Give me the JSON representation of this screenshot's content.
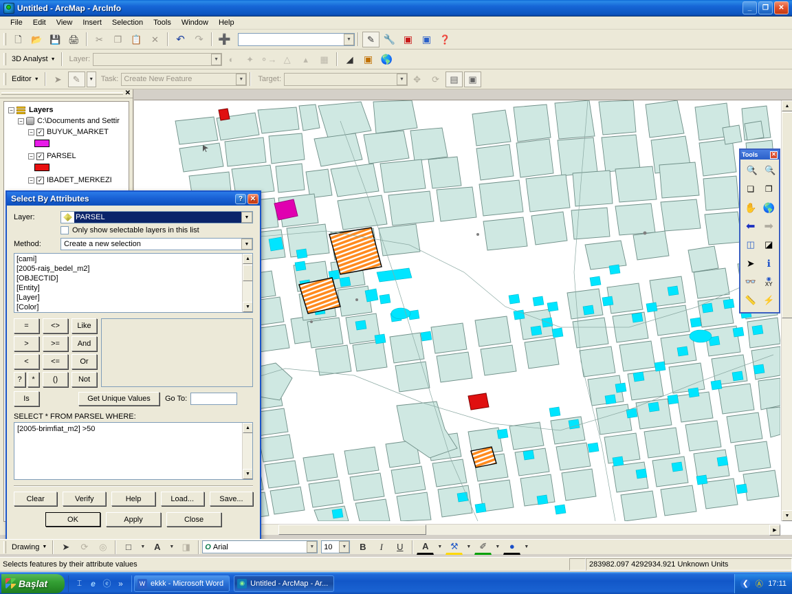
{
  "window": {
    "title": "Untitled - ArcMap - ArcInfo",
    "minimize": "_",
    "maximize": "❐",
    "close": "✕"
  },
  "menubar": {
    "items": [
      "File",
      "Edit",
      "View",
      "Insert",
      "Selection",
      "Tools",
      "Window",
      "Help"
    ]
  },
  "toolbars": {
    "standard": {
      "buttons": [
        {
          "name": "new-document-icon",
          "glyph": "🗋"
        },
        {
          "name": "open-document-icon",
          "glyph": "📂"
        },
        {
          "name": "save-icon",
          "glyph": "💾"
        },
        {
          "name": "print-icon",
          "glyph": "🖨"
        },
        {
          "name": "cut-icon",
          "glyph": "✂"
        },
        {
          "name": "copy-icon",
          "glyph": "❐"
        },
        {
          "name": "paste-icon",
          "glyph": "📋"
        },
        {
          "name": "delete-icon",
          "glyph": "✕"
        },
        {
          "name": "undo-icon",
          "glyph": "↶"
        },
        {
          "name": "redo-icon",
          "glyph": "↷"
        },
        {
          "name": "add-data-icon",
          "glyph": "➕"
        }
      ],
      "scale_value": "",
      "editor_toolbar_icon": "✎",
      "right_buttons": [
        {
          "name": "arctoolbox-icon",
          "glyph": "🔧"
        },
        {
          "name": "command-line-icon",
          "glyph": "▣"
        },
        {
          "name": "show-help-icon",
          "glyph": "❓"
        }
      ]
    },
    "analyst3d": {
      "menu_label": "3D Analyst",
      "layer_label": "Layer:",
      "layer_value": ""
    },
    "editor": {
      "menu_label": "Editor",
      "task_label": "Task:",
      "task_value": "Create New Feature",
      "target_label": "Target:",
      "target_value": ""
    },
    "drawing": {
      "menu_label": "Drawing",
      "font_name": "Arial",
      "font_size": "10",
      "bold": "B",
      "italic": "I",
      "underline": "U",
      "font_color": "A",
      "fill_color": "⚒",
      "line_color": "✐",
      "marker_color": "●"
    }
  },
  "toc": {
    "close_label": "✕",
    "nodes": [
      {
        "label": "Layers",
        "kind": "root"
      },
      {
        "label": "C:\\Documents and Settir",
        "kind": "datasource"
      },
      {
        "label": "BUYUK_MARKET",
        "kind": "layer",
        "checked": true,
        "swatch": "#e81ce8"
      },
      {
        "label": "PARSEL",
        "kind": "layer",
        "checked": true,
        "swatch": "#e81010"
      },
      {
        "label": "IBADET_MERKEZI",
        "kind": "layer",
        "checked": true,
        "swatch": "#d02020"
      }
    ]
  },
  "tools_palette": {
    "title": "Tools",
    "close_label": "✕",
    "tools": [
      {
        "name": "zoom-in-icon",
        "glyph": "🔍",
        "sign": "+"
      },
      {
        "name": "zoom-out-icon",
        "glyph": "🔍",
        "sign": "−"
      },
      {
        "name": "fixed-zoom-in-icon",
        "glyph": "✥"
      },
      {
        "name": "fixed-zoom-out-icon",
        "glyph": "⤢"
      },
      {
        "name": "pan-icon",
        "glyph": "✋"
      },
      {
        "name": "full-extent-globe-icon",
        "glyph": "🌎"
      },
      {
        "name": "go-back-extent-icon",
        "glyph": "⬅"
      },
      {
        "name": "go-forward-extent-icon",
        "glyph": "➡"
      },
      {
        "name": "select-features-icon",
        "glyph": "◱"
      },
      {
        "name": "clear-selected-features-icon",
        "glyph": "◻"
      },
      {
        "name": "select-elements-arrow-icon",
        "glyph": "➤"
      },
      {
        "name": "identify-icon",
        "glyph": "ℹ"
      },
      {
        "name": "find-binoculars-icon",
        "glyph": "🔎"
      },
      {
        "name": "go-to-xy-icon",
        "glyph": "XY"
      },
      {
        "name": "measure-icon",
        "glyph": "📏"
      },
      {
        "name": "hyperlink-icon",
        "glyph": "⚡"
      }
    ]
  },
  "dialog": {
    "title": "Select By Attributes",
    "help_btn": "?",
    "close_btn": "✕",
    "layer_label": "Layer:",
    "layer_value": "PARSEL",
    "only_selectable_label": "Only show selectable layers in this list",
    "only_selectable_checked": false,
    "method_label": "Method:",
    "method_value": "Create a new selection",
    "fields": [
      "[cami]",
      "[2005-raiş_bedel_m2]",
      "[OBJECTID]",
      "[Entity]",
      "[Layer]",
      "[Color]"
    ],
    "operators": [
      [
        "=",
        "<>",
        "Like"
      ],
      [
        ">",
        ">=",
        "And"
      ],
      [
        "<",
        "<=",
        "Or"
      ],
      [
        "?",
        "*",
        "()",
        "Not"
      ]
    ],
    "is_label": "Is",
    "get_unique_values_label": "Get Unique Values",
    "goto_label": "Go To:",
    "goto_value": "",
    "select_clause_label": "SELECT * FROM PARSEL WHERE:",
    "where_expression": "[2005-brimfiat_m2] >50",
    "action_buttons": [
      "Clear",
      "Verify",
      "Help",
      "Load...",
      "Save..."
    ],
    "bottom_buttons": [
      "OK",
      "Apply",
      "Close"
    ]
  },
  "statusbar": {
    "message": "Selects features by their attribute values",
    "coordinates": "283982.097  4292934.921 Unknown Units"
  },
  "taskbar": {
    "start_label": "Başlat",
    "quicklaunch": [
      {
        "name": "show-desktop-icon",
        "glyph": "⌶"
      },
      {
        "name": "internet-explorer-icon",
        "glyph": "e"
      },
      {
        "name": "browser-icon",
        "glyph": "ⓔ"
      },
      {
        "name": "more-icon",
        "glyph": "»"
      }
    ],
    "tasks": [
      {
        "label": "ekkk - Microsoft Word",
        "icon": "W",
        "active": false
      },
      {
        "label": "Untitled - ArcMap - Ar...",
        "icon": "◉",
        "active": true
      }
    ],
    "tray_icons": [
      {
        "name": "show-hidden-icons-icon",
        "glyph": "❮"
      },
      {
        "name": "antivirus-tray-icon",
        "glyph": "Ⓐ"
      }
    ],
    "clock": "17:11"
  },
  "map": {
    "background": "#ffffff",
    "parcel_fill": "#cfe8e2",
    "parcel_stroke": "#6f8f88",
    "selection_color": "#00e5ff",
    "highlight_orange": "#ff8a1e",
    "highlight_magenta": "#e000b0",
    "highlight_red": "#e01010",
    "highlight_blue": "#8fb8e8"
  }
}
